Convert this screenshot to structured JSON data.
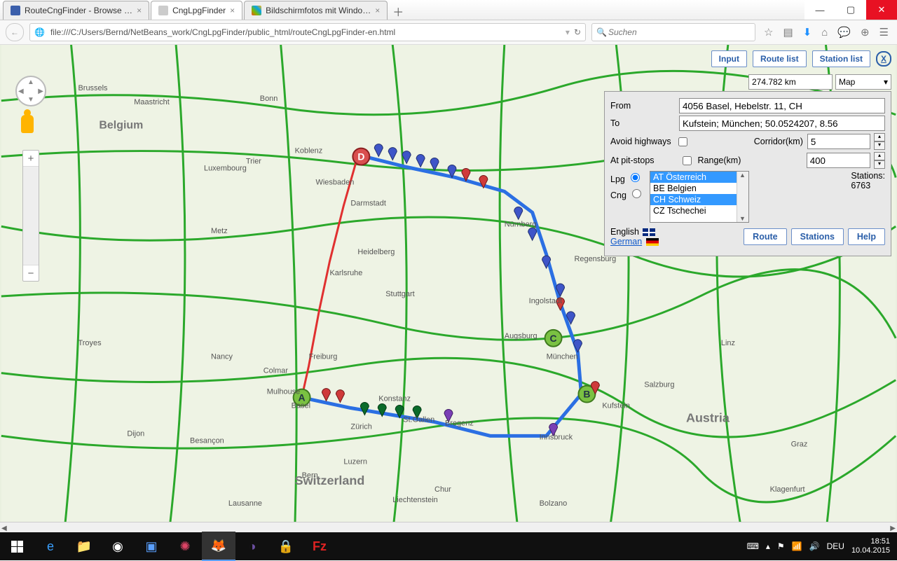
{
  "window": {
    "tabs": [
      {
        "label": "RouteCngFinder - Browse …",
        "active": false
      },
      {
        "label": "CngLpgFinder",
        "active": true
      },
      {
        "label": "Bildschirmfotos mit Windo…",
        "active": false
      }
    ],
    "url": "file:///C:/Users/Bernd/NetBeans_work/CngLpgFinder/public_html/routeCngLpgFinder-en.html",
    "search_placeholder": "Suchen"
  },
  "app": {
    "buttons": {
      "input": "Input",
      "route_list": "Route list",
      "station_list": "Station list"
    },
    "distance": "274.782 km",
    "maptype": "Map"
  },
  "panel": {
    "from_label": "From",
    "from_value": "4056 Basel, Hebelstr. 11, CH",
    "to_label": "To",
    "to_value": "Kufstein; München; 50.0524207, 8.56",
    "avoid_label": "Avoid highways",
    "corridor_label": "Corridor(km)",
    "corridor_value": "5",
    "pitstops_label": "At pit-stops",
    "range_label": "Range(km)",
    "range_value": "400",
    "fuel": {
      "lpg": "Lpg",
      "cng": "Cng"
    },
    "countries": [
      "AT Österreich",
      "BE Belgien",
      "CH Schweiz",
      "CZ Tschechei"
    ],
    "countries_selected": [
      0,
      2
    ],
    "stations_label": "Stations:",
    "stations_count": "6763",
    "lang": {
      "en": "English",
      "de": "German"
    },
    "action": {
      "route": "Route",
      "stations": "Stations",
      "help": "Help"
    }
  },
  "taskbar": {
    "lang": "DEU",
    "time": "18:51",
    "date": "10.04.2015"
  },
  "map": {
    "countries": [
      "Belgium",
      "Switzerland",
      "Austria",
      "Liechtenstein"
    ],
    "sample_cities": [
      "Brussels",
      "Maastricht",
      "Bonn",
      "Koblenz",
      "Wiesbaden",
      "Darmstadt",
      "Heidelberg",
      "Karlsruhe",
      "Stuttgart",
      "Freiburg",
      "Basel",
      "Zürich",
      "Konstanz",
      "St.Gallen",
      "Bregenz",
      "Innsbruck",
      "Kufstein",
      "Salzburg",
      "München",
      "Augsburg",
      "Ingolstadt",
      "Nürnberg",
      "Regensburg",
      "Linz",
      "Graz",
      "Klagenfurt",
      "Nancy",
      "Dijon",
      "Besançon",
      "Colmar",
      "Mulhouse",
      "Metz",
      "Luxembourg",
      "Trier",
      "Troyes",
      "Bern",
      "Lausanne",
      "Luzern",
      "Chur",
      "Bolzano"
    ]
  }
}
